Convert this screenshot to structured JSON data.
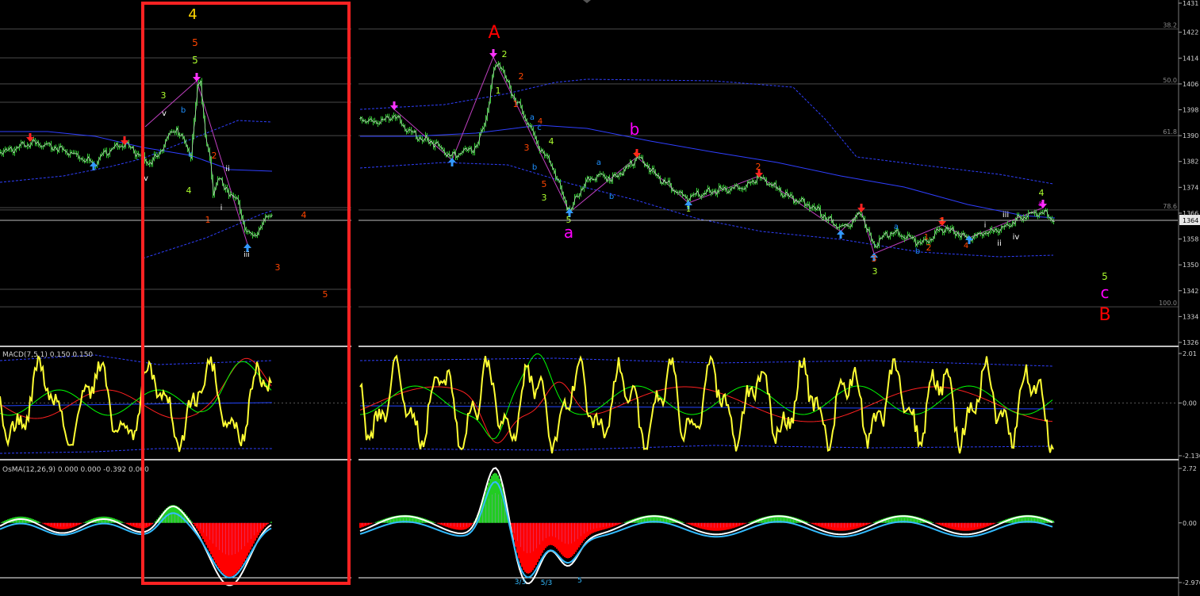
{
  "chart_data": [
    {
      "type": "line",
      "panel": "price",
      "y_ticks": [
        "1431",
        "1422",
        "1414",
        "1406",
        "1398",
        "1390",
        "1382",
        "1374",
        "1366",
        "1358",
        "1350",
        "1342",
        "1334",
        "1326"
      ],
      "ylim": [
        1326,
        1431
      ],
      "current_price": "1364",
      "fib_levels": [
        {
          "label": "38.2",
          "value": 1423
        },
        {
          "label": "50.0",
          "value": 1406
        },
        {
          "label": "61.8",
          "value": 1390
        },
        {
          "label": "78.6",
          "value": 1367
        },
        {
          "label": "100.0",
          "value": 1337
        }
      ],
      "wave_labels": [
        {
          "text": "4",
          "color": "#ffd700",
          "size": 18
        },
        {
          "text": "5",
          "color": "#ff4500",
          "size": 12
        },
        {
          "text": "5",
          "color": "#adff2f",
          "size": 12
        },
        {
          "text": "3",
          "color": "#adff2f",
          "size": 11
        },
        {
          "text": "v",
          "color": "#ffffff",
          "size": 10
        },
        {
          "text": "b",
          "color": "#1e90ff",
          "size": 10
        },
        {
          "text": "c",
          "color": "#1e90ff",
          "size": 10
        },
        {
          "text": "v",
          "color": "#ffffff",
          "size": 10
        },
        {
          "text": "4",
          "color": "#adff2f",
          "size": 11
        },
        {
          "text": "2",
          "color": "#ff4500",
          "size": 11
        },
        {
          "text": "ii",
          "color": "#ffffff",
          "size": 10
        },
        {
          "text": "i",
          "color": "#ffffff",
          "size": 10
        },
        {
          "text": "1",
          "color": "#ff4500",
          "size": 11
        },
        {
          "text": "iii",
          "color": "#ffffff",
          "size": 9
        },
        {
          "text": "4",
          "color": "#ff4500",
          "size": 11
        },
        {
          "text": "3",
          "color": "#ff4500",
          "size": 11
        },
        {
          "text": "5",
          "color": "#ff4500",
          "size": 11
        },
        {
          "text": "A",
          "color": "#ff0000",
          "size": 22
        },
        {
          "text": "2",
          "color": "#adff2f",
          "size": 11
        },
        {
          "text": "2",
          "color": "#ff4500",
          "size": 11
        },
        {
          "text": "1",
          "color": "#adff2f",
          "size": 11
        },
        {
          "text": "1",
          "color": "#ff4500",
          "size": 11
        },
        {
          "text": "a",
          "color": "#1e90ff",
          "size": 10
        },
        {
          "text": "4",
          "color": "#ff4500",
          "size": 10
        },
        {
          "text": "c",
          "color": "#1e90ff",
          "size": 10
        },
        {
          "text": "3",
          "color": "#ff4500",
          "size": 11
        },
        {
          "text": "4",
          "color": "#adff2f",
          "size": 11
        },
        {
          "text": "b",
          "color": "#1e90ff",
          "size": 10
        },
        {
          "text": "5",
          "color": "#ff4500",
          "size": 11
        },
        {
          "text": "3",
          "color": "#adff2f",
          "size": 11
        },
        {
          "text": "5",
          "color": "#adff2f",
          "size": 11
        },
        {
          "text": "a",
          "color": "#ff00ff",
          "size": 20
        },
        {
          "text": "b",
          "color": "#ff00ff",
          "size": 20
        },
        {
          "text": "a",
          "color": "#1e90ff",
          "size": 10
        },
        {
          "text": "b",
          "color": "#1e90ff",
          "size": 10
        },
        {
          "text": "c",
          "color": "#ff4500",
          "size": 10
        },
        {
          "text": "1",
          "color": "#adff2f",
          "size": 10
        },
        {
          "text": "2",
          "color": "#ff4500",
          "size": 11
        },
        {
          "text": "a",
          "color": "#1e90ff",
          "size": 10
        },
        {
          "text": "3",
          "color": "#ff4500",
          "size": 11
        },
        {
          "text": "3",
          "color": "#adff2f",
          "size": 11
        },
        {
          "text": "b",
          "color": "#1e90ff",
          "size": 10
        },
        {
          "text": "1",
          "color": "#ff4500",
          "size": 10
        },
        {
          "text": "2",
          "color": "#ff4500",
          "size": 11
        },
        {
          "text": "3",
          "color": "#ff4500",
          "size": 11
        },
        {
          "text": "4",
          "color": "#ff4500",
          "size": 10
        },
        {
          "text": "i",
          "color": "#ffffff",
          "size": 10
        },
        {
          "text": "ii",
          "color": "#ffffff",
          "size": 10
        },
        {
          "text": "iii",
          "color": "#ffffff",
          "size": 10
        },
        {
          "text": "iv",
          "color": "#ffffff",
          "size": 10
        },
        {
          "text": "4",
          "color": "#adff2f",
          "size": 11
        },
        {
          "text": "a",
          "color": "#ff00ff",
          "size": 10
        },
        {
          "text": "5",
          "color": "#adff2f",
          "size": 12
        },
        {
          "text": "c",
          "color": "#ff00ff",
          "size": 20
        },
        {
          "text": "B",
          "color": "#ff0000",
          "size": 22
        }
      ]
    },
    {
      "type": "line",
      "panel": "macd",
      "title": "MACD(7,5,1) 0.150 0.150",
      "y_ticks": [
        "2.01",
        "0.00",
        "-2.136"
      ],
      "ylim": [
        -2.136,
        2.01
      ]
    },
    {
      "type": "bar",
      "panel": "osma",
      "title": "OsMA(12,26,9) 0.000 0.000 -0.392 0.000",
      "y_ticks": [
        "2.72",
        "0.00",
        "-2.976"
      ],
      "ylim": [
        -2.976,
        2.72
      ],
      "annotations": [
        "3/3",
        "5/3",
        "5"
      ]
    }
  ],
  "colors": {
    "background": "#000000",
    "candles": "#32cd32",
    "price_line": "#d8d8d8",
    "bands": "#2f3fff",
    "macd_yellow": "#ffff33",
    "signal_green": "#00ff00",
    "signal_red": "#ff2020",
    "osma_green": "#22cc22",
    "osma_red": "#ff0000",
    "highlight_box": "#ff2222",
    "arrow_red": "#ff2222",
    "arrow_magenta": "#ff33ff",
    "arrow_blue": "#3399ff"
  }
}
